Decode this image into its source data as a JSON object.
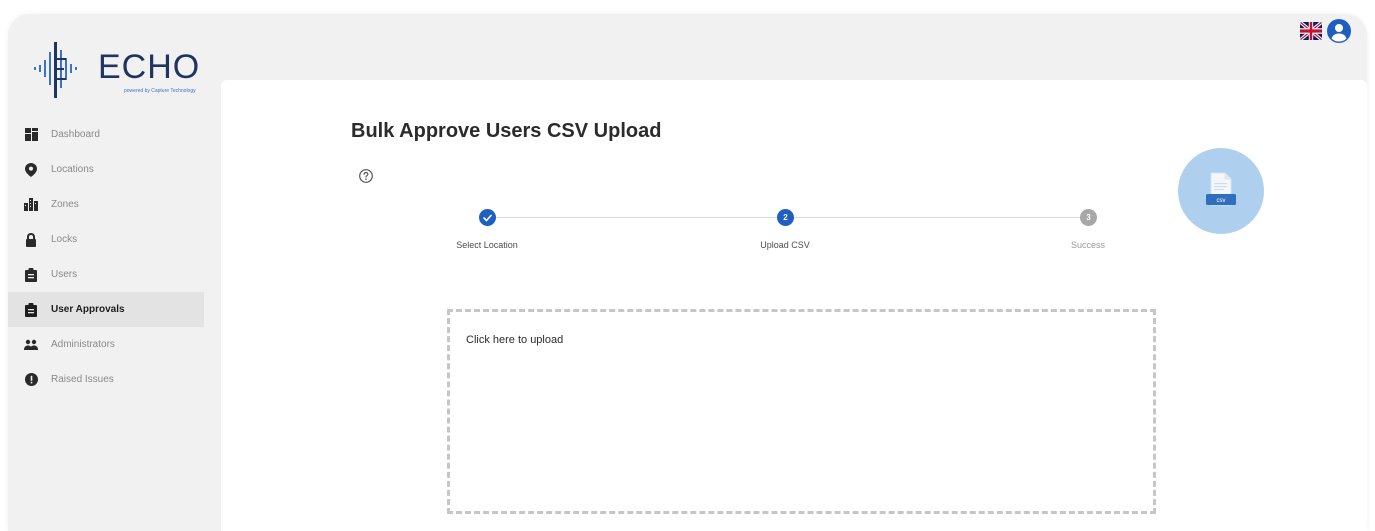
{
  "app": {
    "brand": "ECHO",
    "brand_subtitle": "powered by Capture Technology"
  },
  "sidebar": {
    "items": [
      {
        "label": "Dashboard",
        "icon": "dashboard-icon",
        "active": false
      },
      {
        "label": "Locations",
        "icon": "location-pin-icon",
        "active": false
      },
      {
        "label": "Zones",
        "icon": "buildings-icon",
        "active": false
      },
      {
        "label": "Locks",
        "icon": "lock-icon",
        "active": false
      },
      {
        "label": "Users",
        "icon": "clipboard-icon",
        "active": false
      },
      {
        "label": "User Approvals",
        "icon": "clipboard-check-icon",
        "active": true
      },
      {
        "label": "Administrators",
        "icon": "people-icon",
        "active": false
      },
      {
        "label": "Raised Issues",
        "icon": "alert-circle-icon",
        "active": false
      }
    ]
  },
  "header": {
    "language_icon": "uk-flag-icon",
    "account_icon": "user-avatar-icon"
  },
  "main": {
    "title": "Bulk Approve Users CSV Upload",
    "help_icon": "help-circle-icon",
    "steps": [
      {
        "label": "Select Location",
        "number": "1",
        "state": "complete"
      },
      {
        "label": "Upload CSV",
        "number": "2",
        "state": "active"
      },
      {
        "label": "Success",
        "number": "3",
        "state": "pending"
      }
    ],
    "csv_badge_label": "csv",
    "upload_prompt": "Click here to upload"
  },
  "colors": {
    "accent": "#1f5fbf",
    "pending": "#a8a8a8",
    "brand_navy": "#1f3561",
    "brand_blue": "#3b74c9",
    "csv_badge_bg": "#aed0ee"
  }
}
